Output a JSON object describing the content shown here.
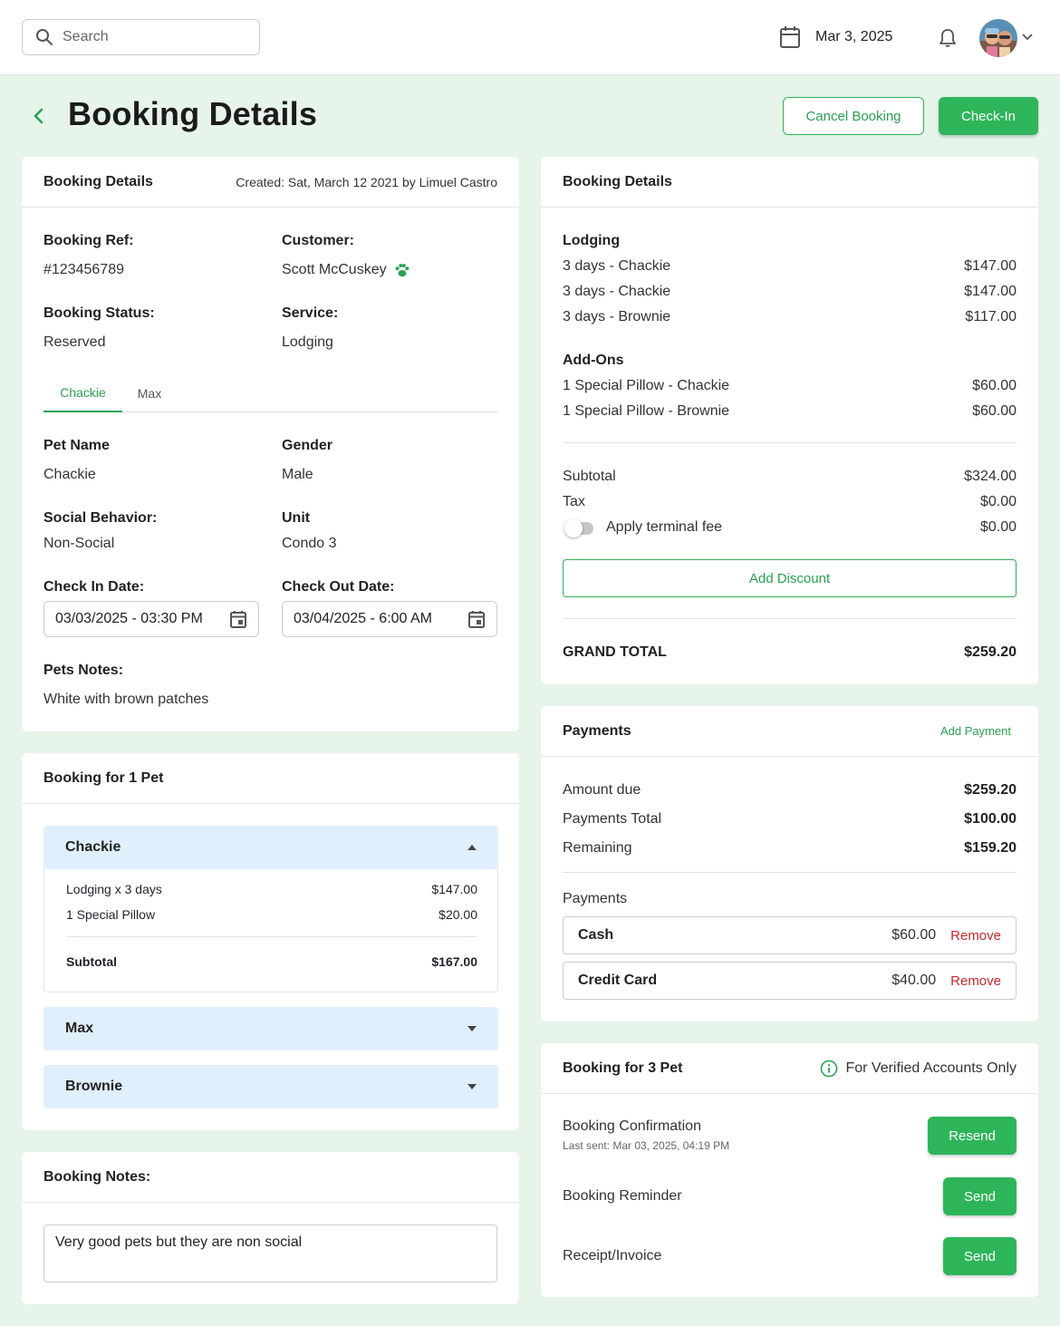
{
  "topbar": {
    "search_placeholder": "Search",
    "date": "Mar 3, 2025",
    "icons": [
      "search-icon",
      "calendar-icon",
      "bell-icon",
      "avatar",
      "chevron-down-icon"
    ]
  },
  "header": {
    "title": "Booking Details",
    "cancel_label": "Cancel Booking",
    "checkin_label": "Check-In"
  },
  "details": {
    "title": "Booking Details",
    "created": "Created: Sat, March 12 2021 by Limuel Castro",
    "ref_label": "Booking Ref:",
    "ref_value": "#123456789",
    "customer_label": "Customer:",
    "customer_value": "Scott McCuskey",
    "status_label": "Booking Status:",
    "status_value": "Reserved",
    "service_label": "Service:",
    "service_value": "Lodging",
    "tabs": [
      "Chackie",
      "Max"
    ],
    "pet_name_label": "Pet Name",
    "pet_name_value": "Chackie",
    "gender_label": "Gender",
    "gender_value": "Male",
    "social_label": "Social Behavior:",
    "social_value": "Non-Social",
    "unit_label": "Unit",
    "unit_value": "Condo 3",
    "checkin_label": "Check In Date:",
    "checkin_value": "03/03/2025 - 03:30 PM",
    "checkout_label": "Check Out Date:",
    "checkout_value": "03/04/2025 - 6:00 AM",
    "notes_label": "Pets Notes:",
    "notes_value": "White with brown patches"
  },
  "pets_booking": {
    "title": "Booking for 1 Pet",
    "pets": [
      "Chackie",
      "Max",
      "Brownie"
    ],
    "chackie_lines": [
      {
        "label": "Lodging x 3 days",
        "amount": "$147.00"
      },
      {
        "label": "1 Special Pillow",
        "amount": "$20.00"
      }
    ],
    "subtotal_label": "Subtotal",
    "subtotal_value": "$167.00"
  },
  "booking_notes": {
    "title": "Booking Notes:",
    "value": "Very good pets but they are non social"
  },
  "summary": {
    "title": "Booking Details",
    "lodging_label": "Lodging",
    "lodging": [
      {
        "label": "3 days - Chackie",
        "amount": "$147.00"
      },
      {
        "label": "3 days - Chackie",
        "amount": "$147.00"
      },
      {
        "label": "3 days - Brownie",
        "amount": "$117.00"
      }
    ],
    "addons_label": "Add-Ons",
    "addons": [
      {
        "label": "1 Special Pillow - Chackie",
        "amount": "$60.00"
      },
      {
        "label": "1 Special Pillow - Brownie",
        "amount": "$60.00"
      }
    ],
    "subtotal_label": "Subtotal",
    "subtotal_value": "$324.00",
    "tax_label": "Tax",
    "tax_value": "$0.00",
    "fee_label": "Apply terminal fee",
    "fee_value": "$0.00",
    "fee_enabled": false,
    "discount_label": "Add Discount",
    "grand_label": "GRAND TOTAL",
    "grand_value": "$259.20"
  },
  "payments": {
    "title": "Payments",
    "add_label": "Add Payment",
    "due_label": "Amount due",
    "due_value": "$259.20",
    "total_label": "Payments Total",
    "total_value": "$100.00",
    "remaining_label": "Remaining",
    "remaining_value": "$159.20",
    "list_label": "Payments",
    "items": [
      {
        "method": "Cash",
        "amount": "$60.00",
        "action": "Remove"
      },
      {
        "method": "Credit Card",
        "amount": "$40.00",
        "action": "Remove"
      }
    ]
  },
  "comms": {
    "title": "Booking for 3 Pet",
    "verified": "For Verified Accounts Only",
    "confirm_label": "Booking Confirmation",
    "confirm_sub": "Last sent: Mar 03, 2025, 04:19 PM",
    "confirm_btn": "Resend",
    "reminder_label": "Booking Reminder",
    "reminder_btn": "Send",
    "receipt_label": "Receipt/Invoice",
    "receipt_btn": "Send"
  },
  "colors": {
    "accent": "#2eb55a",
    "page_bg": "#e6f4ea",
    "accordion_bg": "#e0effc",
    "danger": "#c62828"
  }
}
